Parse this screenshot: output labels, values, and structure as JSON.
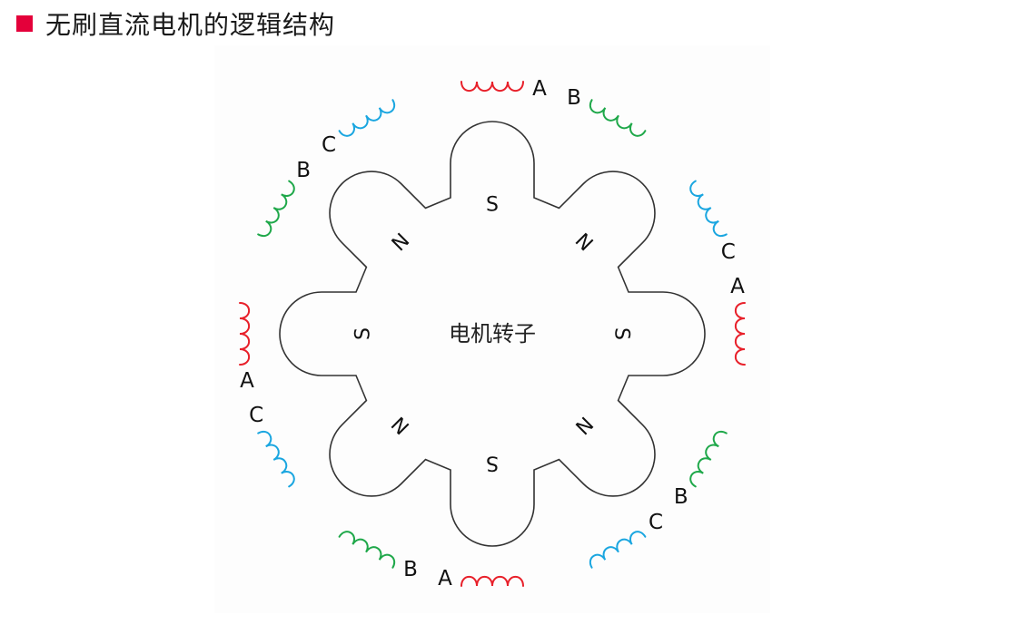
{
  "title": {
    "text": "无刷直流电机的逻辑结构",
    "bullet_color": "#e4003a"
  },
  "rotor": {
    "label": "电机转子",
    "poles": [
      "S",
      "N",
      "S",
      "N",
      "S",
      "N",
      "S",
      "N"
    ],
    "outline_color": "#333333"
  },
  "stator": {
    "coils": [
      {
        "phase": "A"
      },
      {
        "phase": "B"
      },
      {
        "phase": "C"
      },
      {
        "phase": "A"
      },
      {
        "phase": "B"
      },
      {
        "phase": "C"
      },
      {
        "phase": "A"
      },
      {
        "phase": "B"
      },
      {
        "phase": "C"
      },
      {
        "phase": "A"
      },
      {
        "phase": "B"
      },
      {
        "phase": "C"
      }
    ]
  },
  "phase_colors": {
    "A": "#e8202a",
    "B": "#1fa84a",
    "C": "#1aa6e0"
  }
}
